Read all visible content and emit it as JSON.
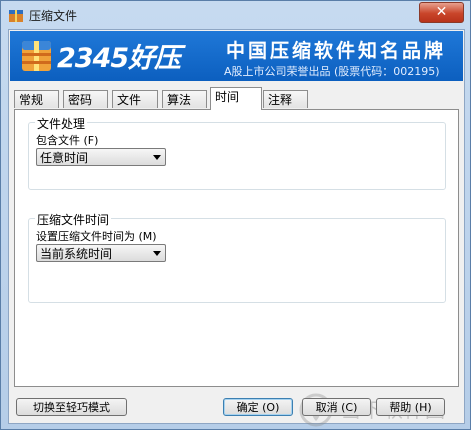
{
  "window": {
    "title": "压缩文件",
    "close_label": "✕"
  },
  "banner": {
    "brand": "2345好压",
    "slogan": "中国压缩软件知名品牌",
    "subline": "A股上市公司荣誉出品 (股票代码：002195)"
  },
  "tabs": [
    {
      "label": "常规",
      "active": false
    },
    {
      "label": "密码",
      "active": false
    },
    {
      "label": "文件",
      "active": false
    },
    {
      "label": "算法",
      "active": false
    },
    {
      "label": "时间",
      "active": true
    },
    {
      "label": "注释",
      "active": false
    }
  ],
  "file_group": {
    "title": "文件处理",
    "field_label": "包含文件 (F)",
    "selected": "任意时间"
  },
  "time_group": {
    "title": "压缩文件时间",
    "field_label": "设置压缩文件时间为 (M)",
    "selected": "当前系统时间"
  },
  "buttons": {
    "simple_mode": "切换至轻巧模式",
    "ok": "确定 (O)",
    "cancel": "取消 (C)",
    "help": "帮助 (H)"
  },
  "watermark": {
    "text": "当下软件园"
  },
  "colors": {
    "banner": "#1f78d8",
    "close_button": "#c9452a"
  }
}
